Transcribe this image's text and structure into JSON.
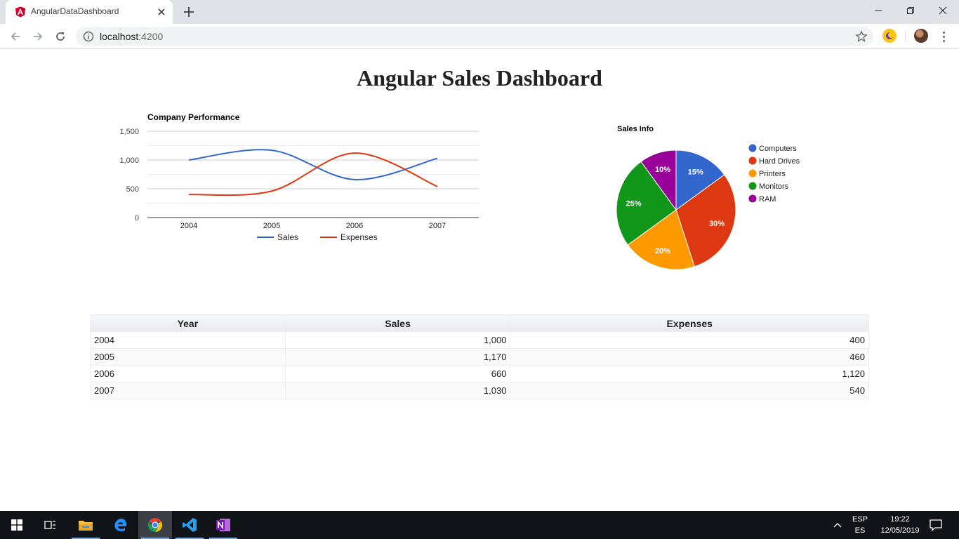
{
  "browser": {
    "tab_title": "AngularDataDashboard",
    "url_host": "localhost",
    "url_port": ":4200",
    "icons": [
      "angular-favicon",
      "close-icon",
      "plus-icon",
      "back-icon",
      "forward-icon",
      "reload-icon",
      "info-icon",
      "star-icon",
      "extension-icon",
      "profile-avatar",
      "menu-icon"
    ]
  },
  "page": {
    "title": "Angular Sales Dashboard"
  },
  "chart_data": [
    {
      "type": "line",
      "title": "Company Performance",
      "categories": [
        "2004",
        "2005",
        "2006",
        "2007"
      ],
      "series": [
        {
          "name": "Sales",
          "values": [
            1000,
            1170,
            660,
            1030
          ],
          "color": "#3366cc"
        },
        {
          "name": "Expenses",
          "values": [
            400,
            460,
            1120,
            540
          ],
          "color": "#dc3912"
        }
      ],
      "ylim": [
        0,
        1500
      ],
      "yticks": [
        "0",
        "500",
        "1,000",
        "1,500"
      ],
      "curve": "smooth",
      "grid": true,
      "legend": "bottom"
    },
    {
      "type": "pie",
      "title": "Sales Info",
      "slices": [
        {
          "label": "Computers",
          "value": 15,
          "text": "15%",
          "color": "#3366cc"
        },
        {
          "label": "Hard Drives",
          "value": 30,
          "text": "30%",
          "color": "#dc3912"
        },
        {
          "label": "Printers",
          "value": 20,
          "text": "20%",
          "color": "#ff9900"
        },
        {
          "label": "Monitors",
          "value": 25,
          "text": "25%",
          "color": "#109618"
        },
        {
          "label": "RAM",
          "value": 10,
          "text": "10%",
          "color": "#990099"
        }
      ],
      "legend": "right"
    }
  ],
  "table": {
    "headers": [
      "Year",
      "Sales",
      "Expenses"
    ],
    "rows": [
      [
        "2004",
        "1,000",
        "400"
      ],
      [
        "2005",
        "1,170",
        "460"
      ],
      [
        "2006",
        "660",
        "1,120"
      ],
      [
        "2007",
        "1,030",
        "540"
      ]
    ]
  },
  "taskbar": {
    "apps": [
      "windows-start",
      "task-view",
      "file-explorer",
      "edge",
      "chrome",
      "vscode",
      "onenote"
    ],
    "lang_top": "ESP",
    "lang_bottom": "ES",
    "time": "19:22",
    "date": "12/05/2019"
  }
}
